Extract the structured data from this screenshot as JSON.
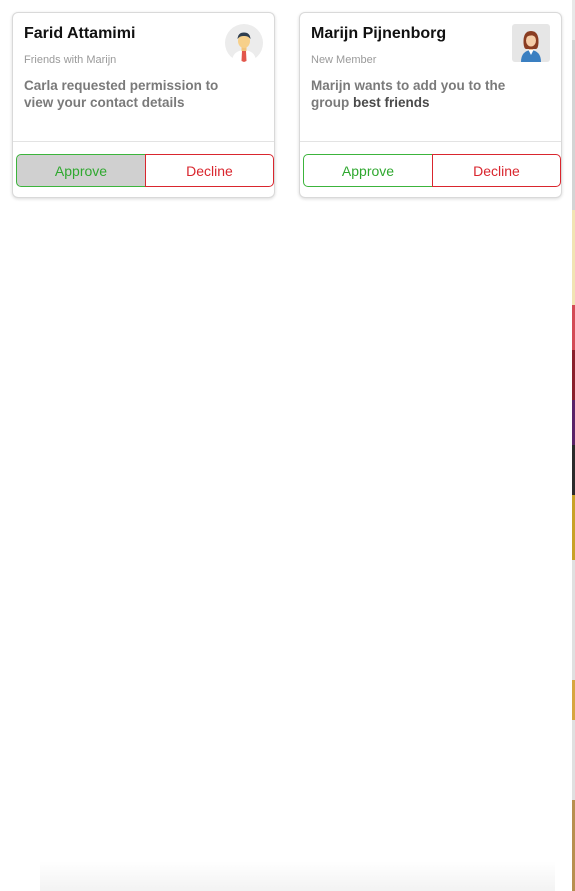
{
  "cards": [
    {
      "name": "Farid Attamimi",
      "subtitle": "Friends with Marijn",
      "message": "Carla requested permission to view your contact details",
      "message_bold": "",
      "avatar_icon": "male-avatar-icon",
      "approve_label": "Approve",
      "decline_label": "Decline",
      "approve_active": true
    },
    {
      "name": "Marijn Pijnenborg",
      "subtitle": "New Member",
      "message": "Marijn wants to add you to the group",
      "message_bold": "best friends",
      "avatar_icon": "female-avatar-icon",
      "approve_label": "Approve",
      "decline_label": "Decline",
      "approve_active": false
    }
  ],
  "colors": {
    "approve": "#2fa82f",
    "decline": "#d9262e",
    "approve_active_bg": "#d0d0d0"
  }
}
